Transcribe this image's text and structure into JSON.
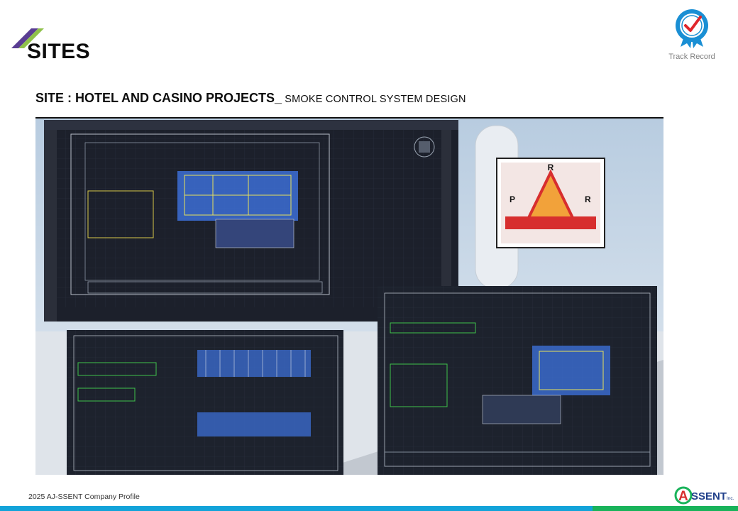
{
  "header": {
    "title": "SITES",
    "accent_colors": [
      "#5a3d93",
      "#8fc14a"
    ]
  },
  "badge": {
    "icon": "award-ribbon-checkmark-icon",
    "label": "Track Record",
    "color": "#1a8fd4"
  },
  "subtitle": {
    "bold_part": "SITE : HOTEL AND CASINO PROJECTS_",
    "light_part": " SMOKE CONTROL SYSTEM DESIGN"
  },
  "photo": {
    "description_icons": [
      "cad-screen-icon",
      "floor-plan-sheet-icon",
      "logo-card-icon"
    ]
  },
  "footer": {
    "text": "2025 AJ-SSENT Company Profile",
    "logo_text": "SSENT",
    "logo_prefix": "A",
    "logo_suffix": "Inc.",
    "bar_colors": [
      "#13a3d9",
      "#19b35a"
    ]
  }
}
